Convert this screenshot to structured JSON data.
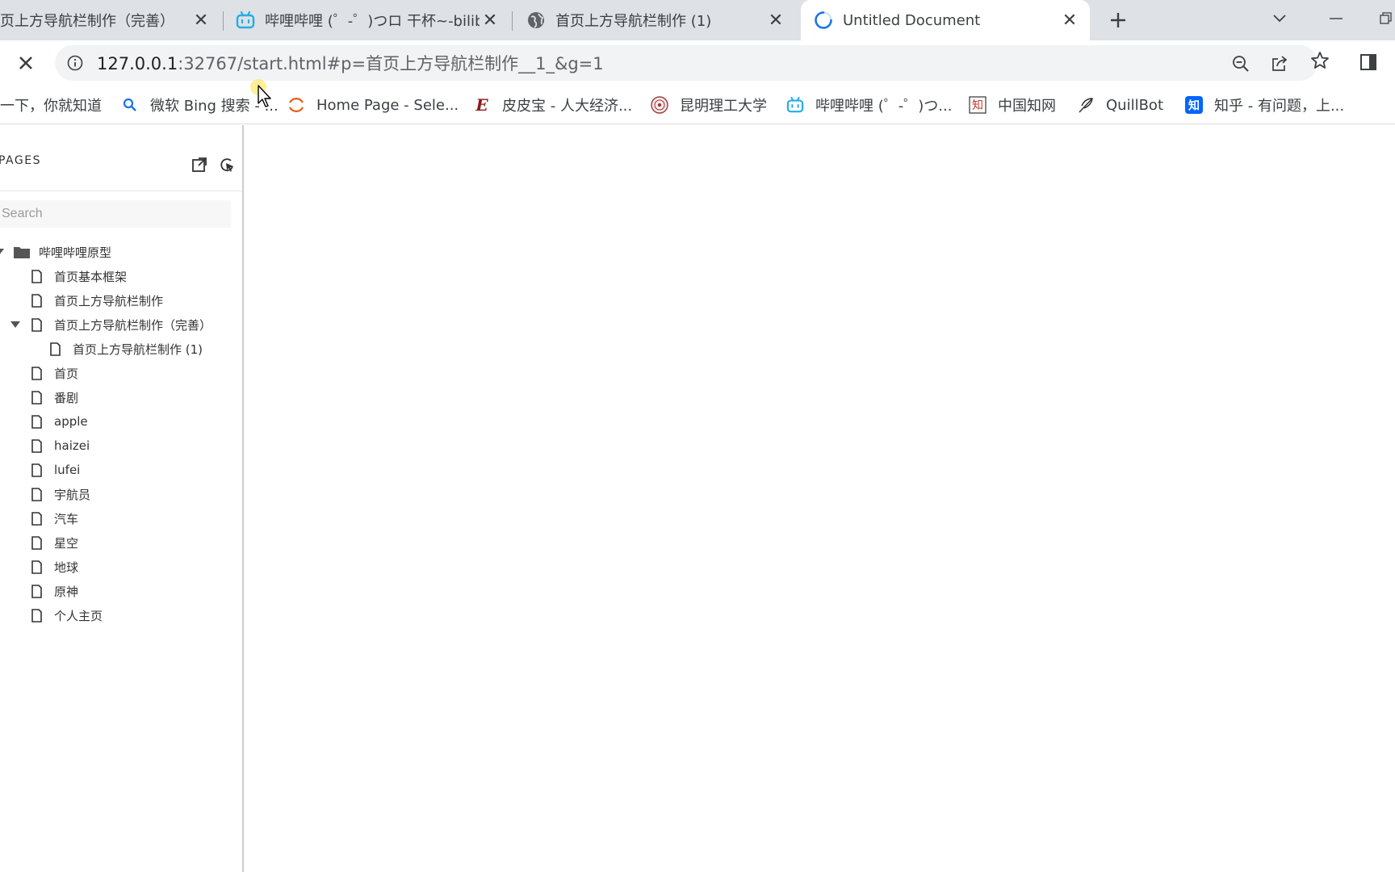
{
  "tabs": [
    {
      "title": "首页上方导航栏制作（完善）",
      "favicon": "none",
      "active": false
    },
    {
      "title": "哔哩哔哩 (゜-゜)つロ 干杯~-bilibili",
      "favicon": "bilibili-icon",
      "active": false
    },
    {
      "title": "首页上方导航栏制作 (1)",
      "favicon": "globe-icon",
      "active": false
    },
    {
      "title": "Untitled Document",
      "favicon": "loading-spinner-icon",
      "active": true
    }
  ],
  "address_bar": {
    "host": "127.0.0.1",
    "rest": ":32767/start.html#p=首页上方导航栏制作__1_&g=1"
  },
  "bookmarks": [
    {
      "label": "一下，你就知道",
      "icon": "none"
    },
    {
      "label": "微软 Bing 搜索 - ...",
      "icon": "search-icon"
    },
    {
      "label": "Home Page - Sele...",
      "icon": "selenium-icon"
    },
    {
      "label": "皮皮宝 - 人大经济...",
      "icon": "e-logo-icon"
    },
    {
      "label": "昆明理工大学",
      "icon": "university-seal-icon"
    },
    {
      "label": "哔哩哔哩 (゜-゜)つ...",
      "icon": "bilibili-icon"
    },
    {
      "label": "中国知网",
      "icon": "cnki-icon"
    },
    {
      "label": "QuillBot",
      "icon": "quill-icon"
    },
    {
      "label": "知乎 - 有问题，上...",
      "icon": "zhihu-icon"
    }
  ],
  "sidebar": {
    "title": "PAGES",
    "search_placeholder": "Search",
    "tree": [
      {
        "label": "哔哩哔哩原型",
        "type": "folder",
        "level": 0
      },
      {
        "label": "首页基本框架",
        "type": "page",
        "level": 1
      },
      {
        "label": "首页上方导航栏制作",
        "type": "page",
        "level": 1
      },
      {
        "label": "首页上方导航栏制作（完善）",
        "type": "page",
        "level": 1,
        "expanded": true
      },
      {
        "label": "首页上方导航栏制作 (1)",
        "type": "page",
        "level": 2
      },
      {
        "label": "首页",
        "type": "page",
        "level": 1
      },
      {
        "label": "番剧",
        "type": "page",
        "level": 1
      },
      {
        "label": "apple",
        "type": "page",
        "level": 1
      },
      {
        "label": "haizei",
        "type": "page",
        "level": 1
      },
      {
        "label": "lufei",
        "type": "page",
        "level": 1
      },
      {
        "label": "宇航员",
        "type": "page",
        "level": 1
      },
      {
        "label": "汽车",
        "type": "page",
        "level": 1
      },
      {
        "label": "星空",
        "type": "page",
        "level": 1
      },
      {
        "label": "地球",
        "type": "page",
        "level": 1
      },
      {
        "label": "原神",
        "type": "page",
        "level": 1
      },
      {
        "label": "个人主页",
        "type": "page",
        "level": 1
      }
    ]
  },
  "colors": {
    "tabstrip_bg": "#dee1e6",
    "omnibox_bg": "#f1f3f4",
    "bilibili": "#23ade5",
    "spinner": "#1a73e8",
    "zhihu": "#0066ff"
  }
}
